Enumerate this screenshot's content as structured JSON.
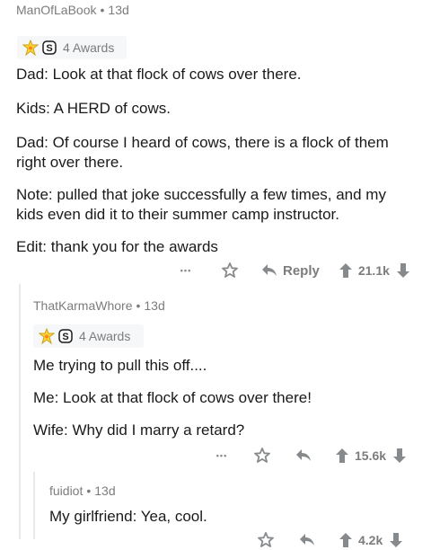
{
  "colors": {
    "text": "#1a1a1b",
    "meta": "#7c7c7c",
    "action": "#878a8c",
    "thread_line": "#e8e8e8",
    "award_bg": "#f6f7f8"
  },
  "comments": [
    {
      "author": "ManOfLaBook",
      "age": "13d",
      "awards": "4 Awards",
      "paragraphs": [
        "Dad: Look at that flock of cows over there.",
        "Kids: A HERD of cows.",
        "Dad: Of course I heard of cows, there is a flock of them",
        "right over there.",
        "Note: pulled that joke successfully a few times, and my",
        "kids even did it to their summer camp instructor.",
        "Edit: thank you for the awards"
      ],
      "more": "•••",
      "reply": "Reply",
      "score": "21.1k"
    },
    {
      "author": "ThatKarmaWhore",
      "age": "13d",
      "awards": "4 Awards",
      "paragraphs": [
        "Me trying to pull this off....",
        "Me: Look at that flock of cows over there!",
        "Wife: Why did I marry a retard?"
      ],
      "more": "•••",
      "score": "15.6k"
    },
    {
      "author": "fuidiot",
      "age": "13d",
      "paragraphs": [
        "My girlfriend: Yea, cool."
      ],
      "score": "4.2k"
    }
  ],
  "icons": [
    "award-medal-icon",
    "silver-award-icon",
    "save-star-icon",
    "reply-arrow-icon",
    "upvote-icon",
    "downvote-icon"
  ]
}
